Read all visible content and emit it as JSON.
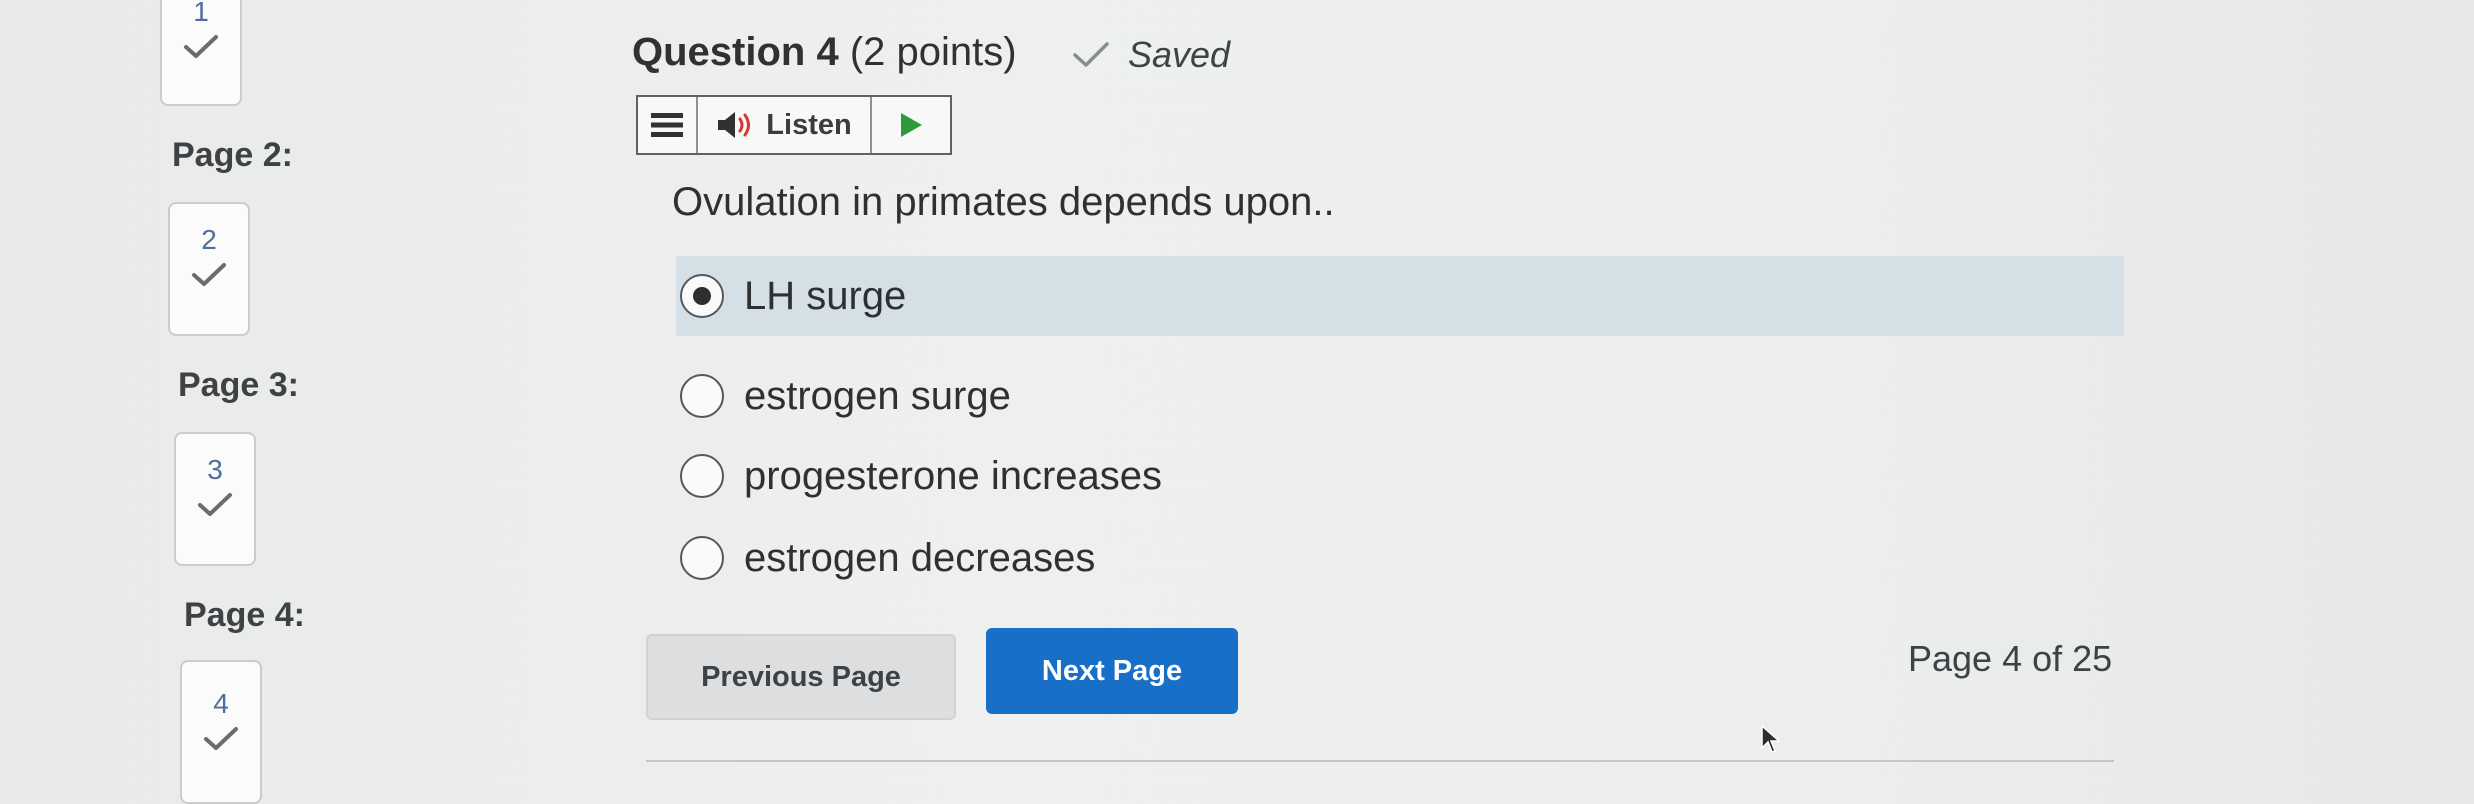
{
  "nav": {
    "pages": [
      {
        "label": "Page 2:",
        "question": "2"
      },
      {
        "label": "Page 3:",
        "question": "3"
      },
      {
        "label": "Page 4:",
        "question": "4"
      }
    ],
    "first_question": "1"
  },
  "question": {
    "title": "Question 4",
    "points": "(2 points)",
    "status": "Saved",
    "text": "Ovulation in primates depends upon..",
    "options": [
      {
        "label": "LH surge",
        "selected": true
      },
      {
        "label": "estrogen surge",
        "selected": false
      },
      {
        "label": "progesterone increases",
        "selected": false
      },
      {
        "label": "estrogen decreases",
        "selected": false
      }
    ]
  },
  "toolbar": {
    "listen_label": "Listen"
  },
  "footer": {
    "prev_label": "Previous Page",
    "next_label": "Next Page",
    "page_count": "Page 4 of 25"
  },
  "colors": {
    "accent": "#176fc8",
    "selected_bg": "#d5e0e6"
  }
}
